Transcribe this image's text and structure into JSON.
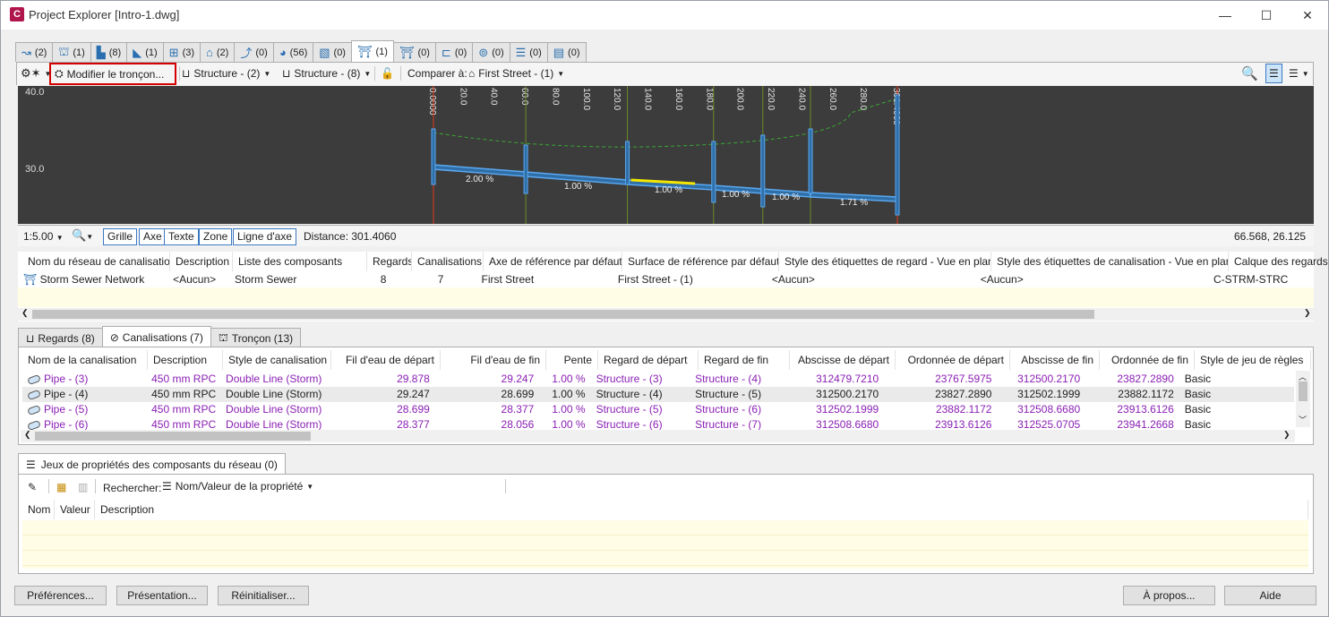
{
  "window": {
    "title": "Project Explorer [Intro-1.dwg]",
    "app_icon": "C",
    "minimize": "—",
    "maximize": "☐",
    "close": "✕"
  },
  "tabs": [
    {
      "icon": "alignment-icon",
      "count": "(2)"
    },
    {
      "icon": "profile-icon",
      "count": "(1)"
    },
    {
      "icon": "profile-view-icon",
      "count": "(8)"
    },
    {
      "icon": "corridor-icon",
      "count": "(1)"
    },
    {
      "icon": "assembly-icon",
      "count": "(3)"
    },
    {
      "icon": "surface-icon",
      "count": "(2)"
    },
    {
      "icon": "feature-line-icon",
      "count": "(0)"
    },
    {
      "icon": "pipe-icon",
      "count": "(56)"
    },
    {
      "icon": "sample-line-icon",
      "count": "(0)"
    },
    {
      "icon": "pipe-network-icon",
      "count": "(1)"
    },
    {
      "icon": "pressure-network-icon",
      "count": "(0)"
    },
    {
      "icon": "section-icon",
      "count": "(0)"
    },
    {
      "icon": "catchment-icon",
      "count": "(0)"
    },
    {
      "icon": "list-icon",
      "count": "(0)"
    },
    {
      "icon": "book-icon",
      "count": "(0)"
    }
  ],
  "toolbar": {
    "edit_run": "Modifier le tronçon...",
    "structure_start": "Structure - (2)",
    "structure_end": "Structure - (8)",
    "compare_label": "Comparer à:",
    "compare_value": "First Street - (1)"
  },
  "profile": {
    "elev_top": "40.0",
    "elev_mid": "30.0",
    "stations": [
      "0.0000",
      "20.0",
      "40.0",
      "60.0",
      "80.0",
      "100.0",
      "120.0",
      "140.0",
      "160.0",
      "180.0",
      "200.0",
      "220.0",
      "240.0",
      "260.0",
      "280.0",
      "301.4060"
    ],
    "slopes": [
      "2.00 %",
      "1.00 %",
      "1.00 %",
      "1.00 %",
      "1.00 %",
      "1.71 %"
    ]
  },
  "status": {
    "scale": "1:5.00",
    "toggles": [
      "Grille",
      "Axe",
      "Texte",
      "Zone",
      "Ligne d'axe"
    ],
    "distance": "Distance: 301.4060",
    "coords": "66.568, 26.125"
  },
  "network_table": {
    "headers": [
      "Nom du réseau de canalisations",
      "Description",
      "Liste des composants",
      "Regards",
      "Canalisations",
      "Axe de référence par défaut",
      "Surface de référence par défaut",
      "Style des étiquettes de regard - Vue en plan",
      "Style des étiquettes de canalisation - Vue en plan",
      "Calque des regards -"
    ],
    "row": [
      "Storm Sewer Network",
      "<Aucun>",
      "Storm Sewer",
      "8",
      "7",
      "First Street",
      "First Street - (1)",
      "<Aucun>",
      "<Aucun>",
      "C-STRM-STRC"
    ]
  },
  "sub_tabs": [
    {
      "label": "Regards (8)"
    },
    {
      "label": "Canalisations (7)"
    },
    {
      "label": "Tronçon (13)"
    }
  ],
  "pipes_table": {
    "headers": [
      "Nom de la canalisation",
      "Description",
      "Style de canalisation",
      "Fil d'eau de départ",
      "Fil d'eau de fin",
      "Pente",
      "Regard de départ",
      "Regard de fin",
      "Abscisse de départ",
      "Ordonnée de départ",
      "Abscisse de fin",
      "Ordonnée de fin",
      "Style de jeu de règles"
    ],
    "rows": [
      [
        "Pipe - (3)",
        "450 mm RPC",
        "Double Line (Storm)",
        "29.878",
        "29.247",
        "1.00 %",
        "Structure - (3)",
        "Structure - (4)",
        "312479.7210",
        "23767.5975",
        "312500.2170",
        "23827.2890",
        "Basic"
      ],
      [
        "Pipe - (4)",
        "450 mm RPC",
        "Double Line (Storm)",
        "29.247",
        "28.699",
        "1.00 %",
        "Structure - (4)",
        "Structure - (5)",
        "312500.2170",
        "23827.2890",
        "312502.1999",
        "23882.1172",
        "Basic"
      ],
      [
        "Pipe - (5)",
        "450 mm RPC",
        "Double Line (Storm)",
        "28.699",
        "28.377",
        "1.00 %",
        "Structure - (5)",
        "Structure - (6)",
        "312502.1999",
        "23882.1172",
        "312508.6680",
        "23913.6126",
        "Basic"
      ],
      [
        "Pipe - (6)",
        "450 mm RPC",
        "Double Line (Storm)",
        "28.377",
        "28.056",
        "1.00 %",
        "Structure - (6)",
        "Structure - (7)",
        "312508.6680",
        "23913.6126",
        "312525.0705",
        "23941.2668",
        "Basic"
      ]
    ]
  },
  "propsets": {
    "tab": "Jeux de propriétés des composants du réseau (0)",
    "search_label": "Rechercher:",
    "search_value": "Nom/Valeur de la propriété",
    "headers": [
      "Nom",
      "Valeur",
      "Description"
    ]
  },
  "buttons": {
    "preferences": "Préférences...",
    "presentation": "Présentation...",
    "reset": "Réinitialiser...",
    "about": "À propos...",
    "help": "Aide"
  },
  "colors": {
    "highlight_border": "#d40000",
    "pipe_blue": "#5aa8f0",
    "selected_yellow": "#f5e600",
    "ground_green": "#3aa832"
  }
}
